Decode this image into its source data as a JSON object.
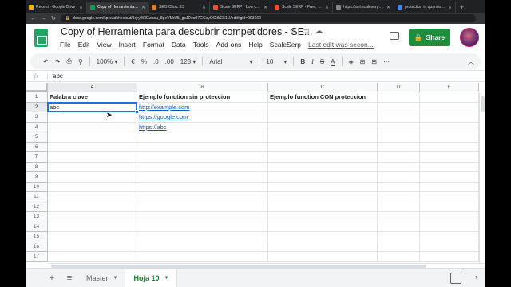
{
  "browser": {
    "tabs": [
      {
        "title": "Recent - Google Drive",
        "color": "#f4b400"
      },
      {
        "title": "Copy of Herramienta para d",
        "color": "#0f9d58",
        "active": true
      },
      {
        "title": "SEO Clinic ES",
        "color": "#e67c22"
      },
      {
        "title": "Scale SERP - Low cost Hig",
        "color": "#e8542e"
      },
      {
        "title": "Scale SERP - Free, Real-Tim",
        "color": "#e8542e"
      },
      {
        "title": "https://api.scaleserp.com/s",
        "color": "#888888"
      },
      {
        "title": "protection in quandoh - Goo",
        "color": "#4285f4"
      }
    ],
    "new_tab": "+",
    "url": "docs.google.com/spreadsheets/d/1rjryW3Ewnsu_8peVMrU5_gcJDeo97GGcyOCjIkG51U/edit#gid=993162"
  },
  "doc": {
    "title": "Copy of Herramienta para descubrir competidores - SE...",
    "menu": [
      "File",
      "Edit",
      "View",
      "Insert",
      "Format",
      "Data",
      "Tools",
      "Add-ons",
      "Help",
      "ScaleSerp"
    ],
    "last_edit": "Last edit was secon...",
    "share_label": "Share"
  },
  "toolbar": {
    "zoom": "100%",
    "currency": "€",
    "percent": "%",
    "dec_less": ".0",
    "dec_more": ".00",
    "format_more": "123",
    "font": "Arial",
    "font_size": "10",
    "bold": "B",
    "italic": "I",
    "strike": "S",
    "text_color": "A"
  },
  "formula_bar": {
    "fx": "fx",
    "value": "abc"
  },
  "columns": [
    "A",
    "B",
    "C",
    "D",
    "E"
  ],
  "rows": [
    "1",
    "2",
    "3",
    "4",
    "5",
    "6",
    "7",
    "8",
    "9",
    "10",
    "11",
    "12",
    "13",
    "14",
    "15",
    "16",
    "17"
  ],
  "cells": {
    "A1": "Palabra clave",
    "B1": "Ejemplo function sin proteccion",
    "C1": "Ejemplo function CON proteccion",
    "A2": "abc",
    "B2": "http://example.com",
    "B3": "https://google.com",
    "B4": "https://abc"
  },
  "sheets": {
    "add": "+",
    "list": "≡",
    "tabs": [
      "Master",
      "Hoja 10"
    ],
    "active": "Hoja 10"
  }
}
